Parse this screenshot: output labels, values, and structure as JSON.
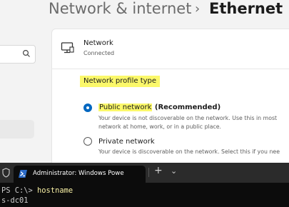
{
  "settings": {
    "breadcrumb": {
      "parent": "Network & internet",
      "separator": "›",
      "current": "Ethernet"
    },
    "network": {
      "title": "Network",
      "status": "Connected"
    },
    "profile": {
      "heading": "Network profile type",
      "public": {
        "name": "Public network",
        "suffix": " (Recommended)",
        "selected": true,
        "desc_line1": "Your device is not discoverable on the network. Use this in most",
        "desc_line2": "network at home, work, or in a public place."
      },
      "private": {
        "name": "Private network",
        "selected": false,
        "desc_line1": "Your device is discoverable on the network. Select this if you nee"
      }
    }
  },
  "terminal": {
    "tab_title": "Administrator: Windows Powe",
    "new_tab": "+",
    "dropdown": "⌄",
    "prompt": "PS C:\\> ",
    "command": "hostname",
    "output": "s-dc01"
  },
  "colors": {
    "accent": "#0067c0",
    "highlight": "#fbf86a",
    "terminal_bg": "#0c0c0c"
  }
}
